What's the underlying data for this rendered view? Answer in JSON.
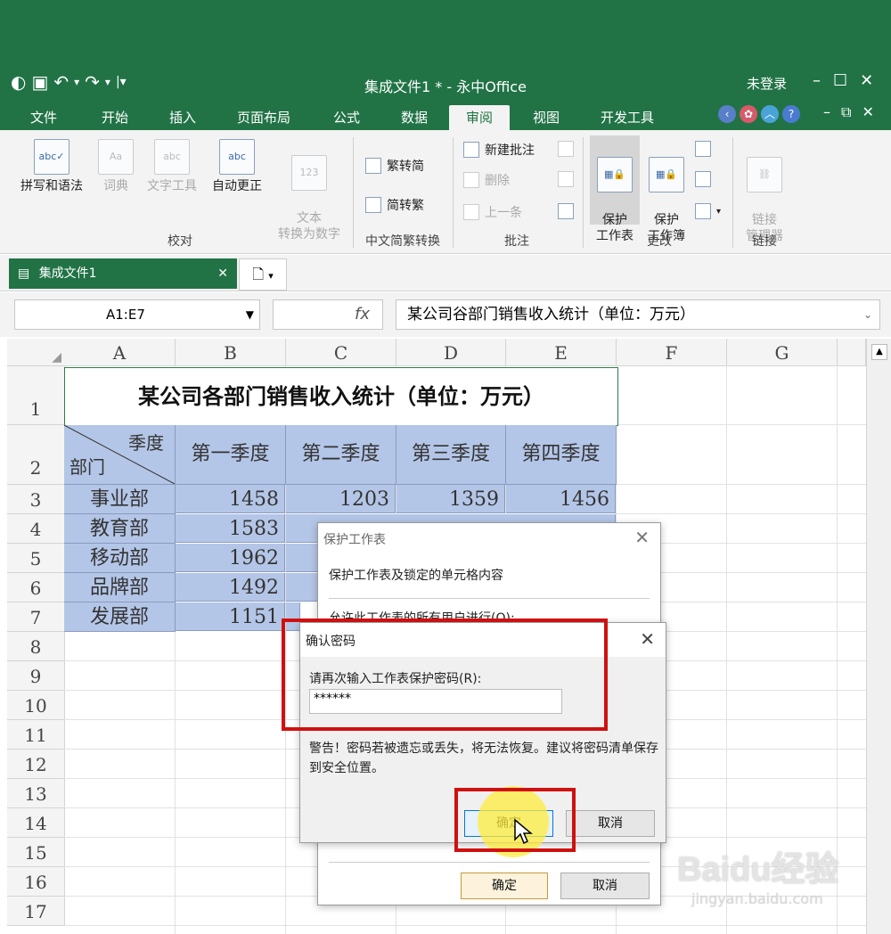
{
  "window": {
    "title": "集成文件1 * - 永中Office",
    "login": "未登录",
    "qat_icons": [
      "app-icon",
      "save-icon",
      "undo-icon",
      "redo-icon",
      "customize-icon"
    ]
  },
  "tabs": [
    "文件",
    "开始",
    "插入",
    "页面布局",
    "公式",
    "数据",
    "审阅",
    "视图",
    "开发工具"
  ],
  "active_tab": "审阅",
  "ribbon": {
    "proof_group": {
      "label": "校对",
      "buttons": [
        "拼写和语法",
        "词典",
        "文字工具",
        "自动更正",
        "文本\n转换为数字"
      ]
    },
    "chinese_group": {
      "label": "中文简繁转换",
      "buttons": [
        "繁转简",
        "简转繁"
      ]
    },
    "comment_group": {
      "label": "批注",
      "buttons": [
        "新建批注",
        "删除",
        "上一条"
      ]
    },
    "changes_group": {
      "label": "更改",
      "buttons": [
        "保护\n工作表",
        "保护\n工作簿"
      ]
    },
    "link_group": {
      "label": "链接",
      "buttons": [
        "链接\n管理器"
      ]
    }
  },
  "doc_tab": {
    "name": "集成文件1"
  },
  "formula_bar": {
    "name_box": "A1:E7",
    "fx": "fx",
    "content": "某公司谷部门销售收入统计（单位：万元）"
  },
  "sheet": {
    "columns": [
      "A",
      "B",
      "C",
      "D",
      "E",
      "F",
      "G"
    ],
    "rows": [
      "1",
      "2",
      "3",
      "4",
      "5",
      "6",
      "7",
      "8",
      "9",
      "10",
      "11",
      "12",
      "13",
      "14",
      "15",
      "16",
      "17"
    ],
    "table_title": "某公司各部门销售收入统计（单位：万元）",
    "corner_top": "季度",
    "corner_bottom": "部门",
    "quarters": [
      "第一季度",
      "第二季度",
      "第三季度",
      "第四季度"
    ],
    "departments": [
      {
        "name": "事业部",
        "values": [
          "1458",
          "1203",
          "1359",
          "1456"
        ]
      },
      {
        "name": "教育部",
        "values": [
          "1583",
          "",
          "",
          ""
        ]
      },
      {
        "name": "移动部",
        "values": [
          "1962",
          "",
          "",
          ""
        ]
      },
      {
        "name": "品牌部",
        "values": [
          "1492",
          "",
          "",
          ""
        ]
      },
      {
        "name": "发展部",
        "values": [
          "1151",
          "",
          "",
          ""
        ]
      }
    ]
  },
  "protect_dialog": {
    "title": "保护工作表",
    "line1": "保护工作表及锁定的单元格内容",
    "line2": "允许此工作表的所有用户进行(O):",
    "ok": "确定",
    "cancel": "取消"
  },
  "confirm_dialog": {
    "title": "确认密码",
    "prompt": "请再次输入工作表保护密码(R):",
    "password": "******",
    "warning": "警告！密码若被遗忘或丢失，将无法恢复。建议将密码清单保存到安全位置。",
    "ok": "确定",
    "cancel": "取消"
  },
  "watermark": {
    "brand": "Baidu经验",
    "url": "jingyan.baidu.com"
  },
  "colors": {
    "accent": "#217346",
    "selection": "#b4c6e7",
    "annotation": "#d01010"
  }
}
